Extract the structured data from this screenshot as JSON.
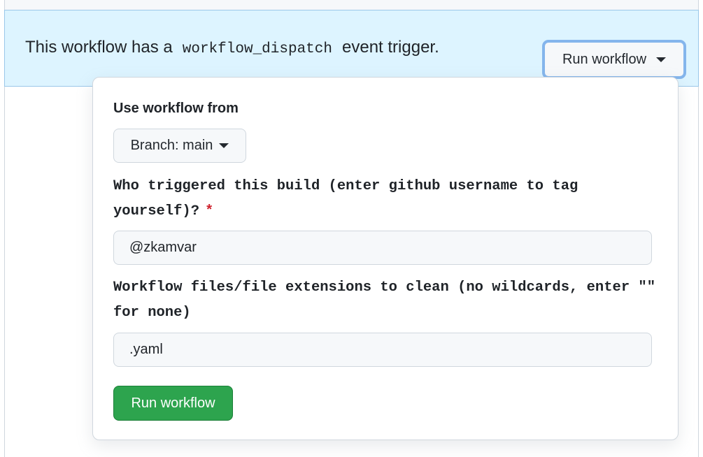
{
  "banner": {
    "text_before": "This workflow has a",
    "code": "workflow_dispatch",
    "text_after": "event trigger.",
    "run_button_label": "Run workflow",
    "background_color": "#ddf4ff"
  },
  "dropdown": {
    "use_from_label": "Use workflow from",
    "branch_button_label": "Branch: main",
    "inputs": [
      {
        "label": "Who triggered this build (enter github username to tag yourself)?",
        "required_marker": "*",
        "value": "@zkamvar"
      },
      {
        "label": "Workflow files/file extensions to clean (no wildcards, enter \"\" for none)",
        "value": ".yaml"
      }
    ],
    "submit_label": "Run workflow",
    "submit_color": "#2da44e"
  },
  "icons": {
    "run_toggle_caret": "chevron-down-icon",
    "branch_caret": "chevron-down-icon"
  }
}
